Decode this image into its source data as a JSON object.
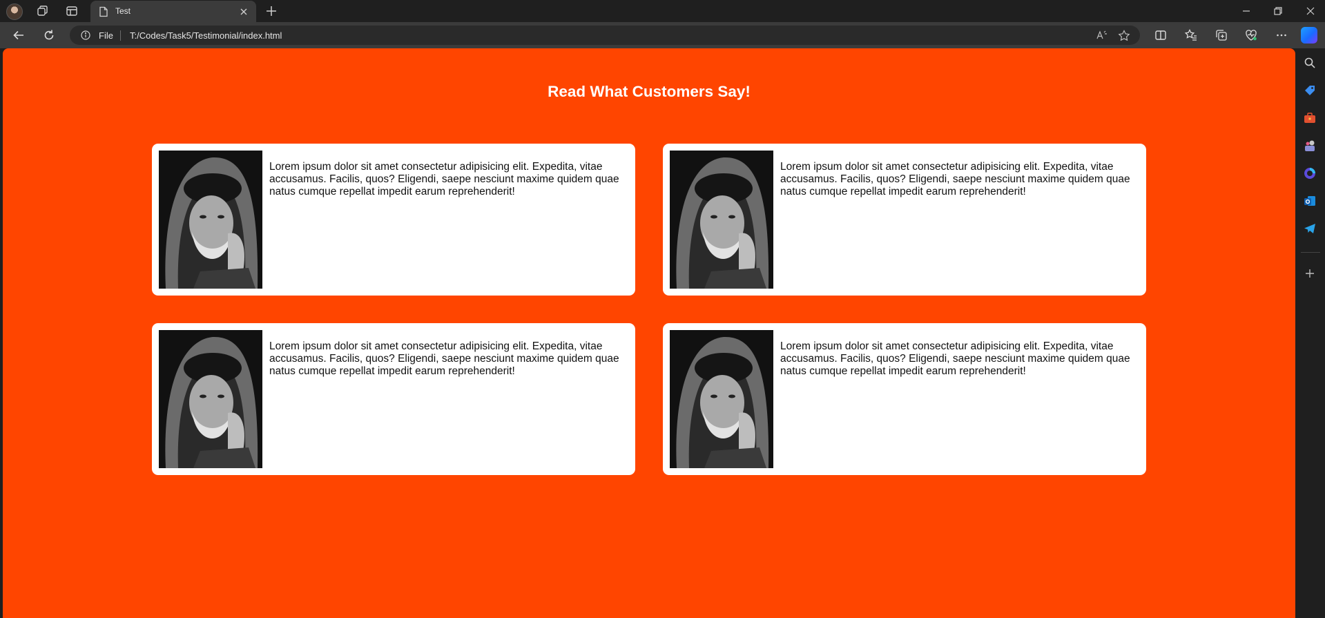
{
  "browser": {
    "tab": {
      "title": "Test"
    },
    "address_bar": {
      "scheme_label": "File",
      "url": "T:/Codes/Task5/Testimonial/index.html"
    }
  },
  "page": {
    "heading": "Read What Customers Say!",
    "background_color": "#ff4500",
    "card_color": "#ffffff",
    "testimonials": [
      {
        "text": "Lorem ipsum dolor sit amet consectetur adipisicing elit. Expedita, vitae accusamus. Facilis, quos? Eligendi, saepe nesciunt maxime quidem quae natus cumque repellat impedit earum reprehenderit!"
      },
      {
        "text": "Lorem ipsum dolor sit amet consectetur adipisicing elit. Expedita, vitae accusamus. Facilis, quos? Eligendi, saepe nesciunt maxime quidem quae natus cumque repellat impedit earum reprehenderit!"
      },
      {
        "text": "Lorem ipsum dolor sit amet consectetur adipisicing elit. Expedita, vitae accusamus. Facilis, quos? Eligendi, saepe nesciunt maxime quidem quae natus cumque repellat impedit earum reprehenderit!"
      },
      {
        "text": "Lorem ipsum dolor sit amet consectetur adipisicing elit. Expedita, vitae accusamus. Facilis, quos? Eligendi, saepe nesciunt maxime quidem quae natus cumque repellat impedit earum reprehenderit!"
      }
    ]
  },
  "icons": {
    "titlebar": [
      "profile-avatar",
      "workspaces-icon",
      "tab-actions-icon",
      "page-icon",
      "close-icon",
      "new-tab-icon",
      "minimize-icon",
      "restore-icon",
      "window-close-icon"
    ],
    "toolbar": [
      "back-icon",
      "refresh-icon",
      "info-icon",
      "read-aloud-icon",
      "favorite-star-icon",
      "split-screen-icon",
      "favorites-icon",
      "collections-icon",
      "browser-essentials-icon",
      "more-icon",
      "copilot-icon"
    ],
    "sidebar": [
      "search-icon",
      "shopping-icon",
      "tools-icon",
      "games-icon",
      "copilot-sidebar-icon",
      "outlook-icon",
      "telegram-icon",
      "add-icon"
    ]
  }
}
